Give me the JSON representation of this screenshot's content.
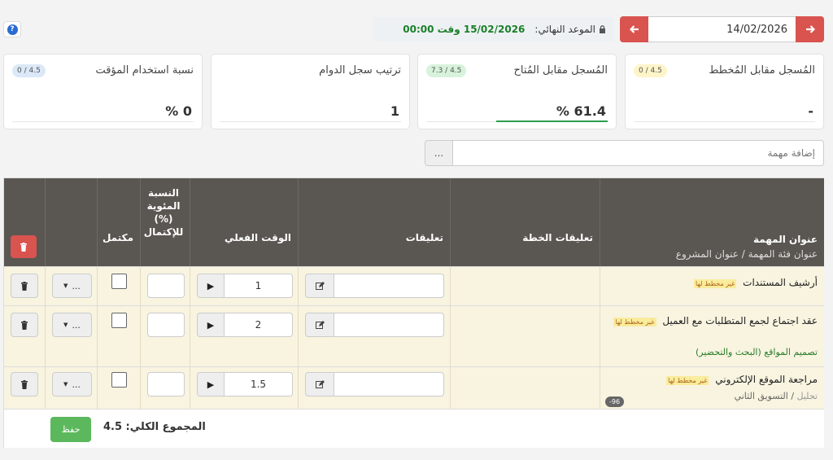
{
  "help": {
    "icon": "help-circle-icon",
    "glyph": "?"
  },
  "date_nav": {
    "date": "14/02/2026",
    "prev_icon": "arrow-left-icon",
    "next_icon": "arrow-right-icon"
  },
  "deadline": {
    "label": "الموعد النهائي:",
    "value": "15/02/2026 وقت 00:00",
    "icon": "lock-icon"
  },
  "cards": [
    {
      "title": "المُسجل مقابل المُخطط",
      "badge": "0 / 4.5",
      "value": "-"
    },
    {
      "title": "المُسجل مقابل المُتاح",
      "badge": "7.3 / 4.5",
      "value": "61.4 %"
    },
    {
      "title": "ترتيب سجل الدوام",
      "badge": "",
      "value": "1"
    },
    {
      "title": "نسبة استخدام المؤقت",
      "badge": "0 / 4.5",
      "value": "0 %"
    }
  ],
  "add_task": {
    "placeholder": "إضافة مهمة",
    "more_label": "..."
  },
  "table": {
    "headers": {
      "task": "عنوان المهمة",
      "task_sub": "عنوان فئة المهمة",
      "task_sub2": "عنوان المشروع",
      "plan_notes": "تعليقات الخطة",
      "notes": "تعليقات",
      "actual_time": "الوقت الفعلي",
      "percent": "النسبة المئوية (%) للإكتمال",
      "done": "مكتمل"
    },
    "unplanned_tag": "غير مخطط لها",
    "rows": [
      {
        "title": "أرشيف المستندات",
        "tag": "غير مخطط لها",
        "time": "1",
        "category": "",
        "sub_a": "",
        "sub_b": ""
      },
      {
        "title": "عقد اجتماع لجمع المتطلبات مع العميل",
        "tag": "غير مخطط لها",
        "time": "2",
        "category": "تصميم المواقع (البحث والتحضير)",
        "sub_a": "",
        "sub_b": ""
      },
      {
        "title": "مراجعة الموقع الإلكتروني",
        "tag": "غير مخطط لها",
        "time": "1.5",
        "category": "",
        "sub_a": "تحليل",
        "sub_b": "التسويق الثاني",
        "pill": "-96"
      }
    ],
    "dropdown_label": "...",
    "footer": {
      "total": "المجموع الكلي: 4.5",
      "save": "حفظ"
    }
  },
  "colors": {
    "header_bg": "#5a5652",
    "row_bg": "#f8f4e0",
    "danger": "#d9534f",
    "success": "#5cb85c",
    "deadline_text": "#1b7f2a"
  }
}
